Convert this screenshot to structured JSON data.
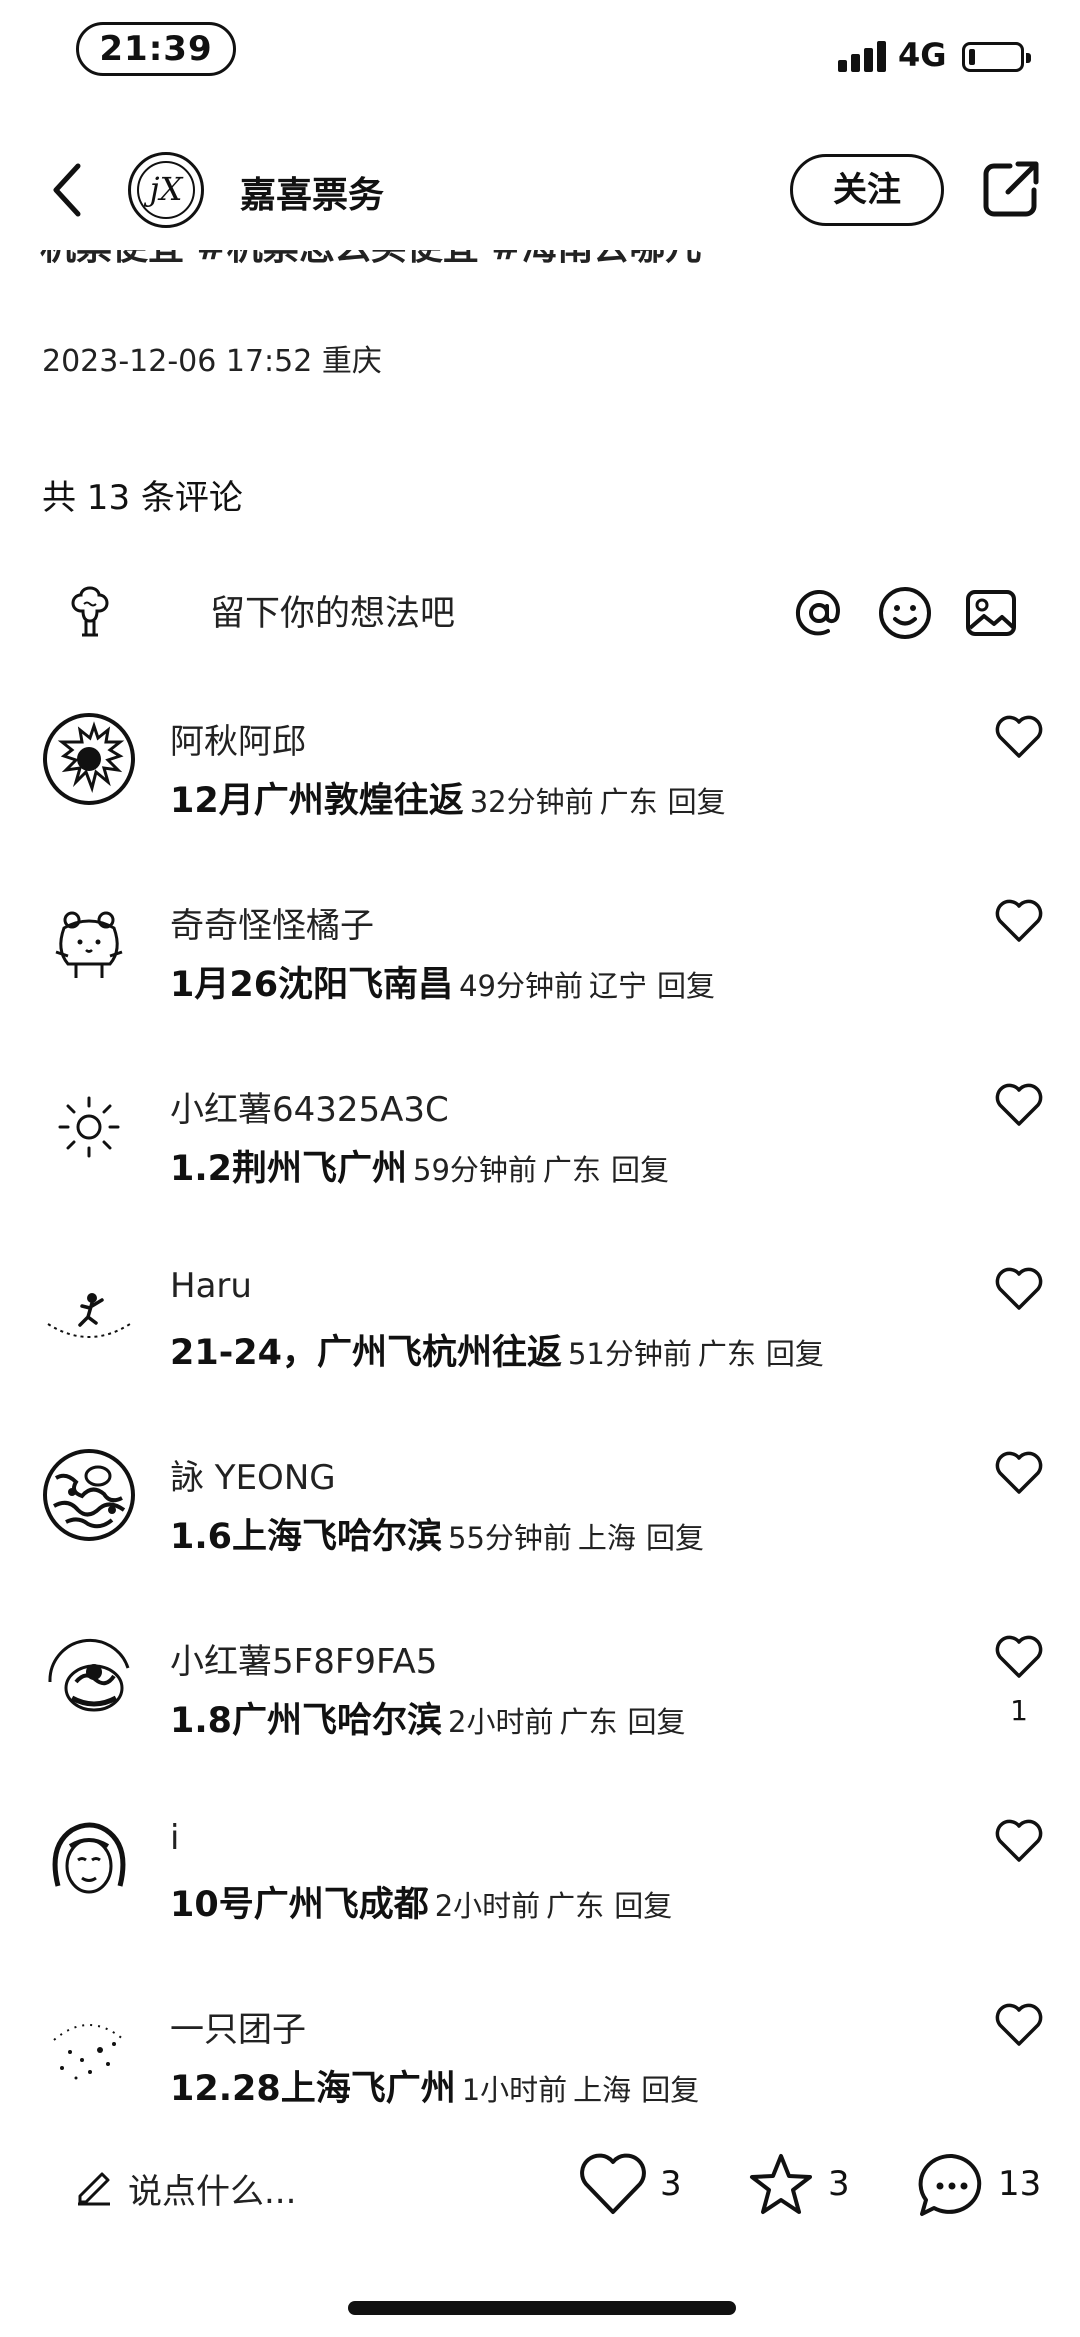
{
  "status_bar": {
    "time": "21:39",
    "network": "4G"
  },
  "header": {
    "author": "嘉喜票务",
    "logo_text": "jX",
    "follow_label": "关注"
  },
  "post": {
    "cut_text": "机票便宜 #机票怎么买便宜 #海南去哪儿",
    "date_location": "2023-12-06 17:52 重庆",
    "comment_count": "共 13 条评论"
  },
  "comment_input": {
    "placeholder": "留下你的想法吧"
  },
  "comments": [
    {
      "name": "阿秋阿邱",
      "text": "12月广州敦煌往返",
      "time": "32分钟前",
      "location": "广东",
      "reply": "回复",
      "likes": ""
    },
    {
      "name": "奇奇怪怪橘子",
      "text": "1月26沈阳飞南昌",
      "time": "49分钟前",
      "location": "辽宁",
      "reply": "回复",
      "likes": ""
    },
    {
      "name": "小红薯64325A3C",
      "text": "1.2荆州飞广州",
      "time": "59分钟前",
      "location": "广东",
      "reply": "回复",
      "likes": ""
    },
    {
      "name": "Haru",
      "text": "21-24，广州飞杭州往返",
      "time": "51分钟前",
      "location": "广东",
      "reply": "回复",
      "likes": ""
    },
    {
      "name": "詠 YEONG",
      "text": "1.6上海飞哈尔滨",
      "time": "55分钟前",
      "location": "上海",
      "reply": "回复",
      "likes": ""
    },
    {
      "name": "小红薯5F8F9FA5",
      "text": "1.8广州飞哈尔滨",
      "time": "2小时前",
      "location": "广东",
      "reply": "回复",
      "likes": "1"
    },
    {
      "name": "  i",
      "text": "10号广州飞成都",
      "time": "2小时前",
      "location": "广东",
      "reply": "回复",
      "likes": ""
    },
    {
      "name": "一只团子",
      "text": "12.28上海飞广州",
      "time": "1小时前",
      "location": "上海",
      "reply": "回复",
      "likes": ""
    }
  ],
  "bottom_bar": {
    "say_placeholder": "说点什么...",
    "likes": "3",
    "favorites": "3",
    "comments": "13"
  }
}
